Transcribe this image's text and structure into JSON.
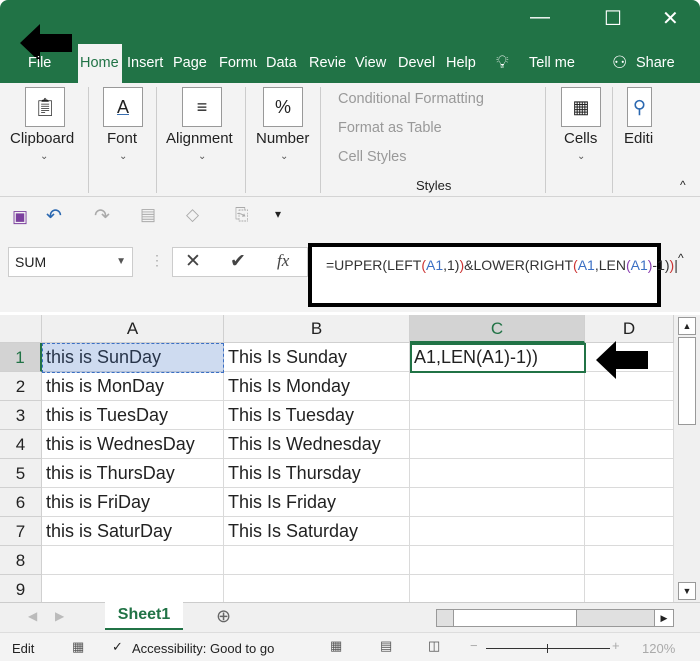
{
  "window": {
    "minimize": "—",
    "maximize": "☐",
    "close": "✕"
  },
  "tabs": [
    "File",
    "Home",
    "Insert",
    "Page L",
    "Formu",
    "Data",
    "Revie",
    "View",
    "Devel",
    "Help"
  ],
  "tell_me": "Tell me",
  "share": "Share",
  "ribbon": {
    "clipboard": "Clipboard",
    "font": "Font",
    "alignment": "Alignment",
    "number": "Number",
    "conditional_formatting": "Conditional Formatting",
    "format_as_table": "Format as Table",
    "cell_styles": "Cell Styles",
    "styles": "Styles",
    "cells": "Cells",
    "editing": "Editi"
  },
  "name_box": "SUM",
  "formula": {
    "p0": "=UPPER(LEFT",
    "p1": "(",
    "p2": "A1",
    "p3": ",1)",
    "p4": ")",
    "p5": "&LOWER(RIGHT",
    "p6": "(",
    "p7": "A1",
    "p8": ",LEN",
    "p9": "(",
    "p10": "A1",
    "p11": ")",
    "p12": "-1)",
    "p13": ")"
  },
  "columns": [
    "A",
    "B",
    "C",
    "D"
  ],
  "rows": [
    {
      "n": "1",
      "a": "this is SunDay",
      "b": "This Is Sunday",
      "c": "A1,LEN(A1)-1))"
    },
    {
      "n": "2",
      "a": "this is MonDay",
      "b": "This Is Monday",
      "c": ""
    },
    {
      "n": "3",
      "a": "this is TuesDay",
      "b": "This Is Tuesday",
      "c": ""
    },
    {
      "n": "4",
      "a": "this is WednesDay",
      "b": "This Is Wednesday",
      "c": ""
    },
    {
      "n": "5",
      "a": "this is ThursDay",
      "b": "This Is Thursday",
      "c": ""
    },
    {
      "n": "6",
      "a": "this is FriDay",
      "b": "This Is Friday",
      "c": ""
    },
    {
      "n": "7",
      "a": "this is SaturDay",
      "b": "This Is Saturday",
      "c": ""
    },
    {
      "n": "8",
      "a": "",
      "b": "",
      "c": ""
    },
    {
      "n": "9",
      "a": "",
      "b": "",
      "c": ""
    }
  ],
  "sheet_tab": "Sheet1",
  "status": {
    "mode": "Edit",
    "accessibility": "Accessibility: Good to go",
    "zoom": "120%"
  },
  "colors": {
    "accent": "#217346"
  }
}
